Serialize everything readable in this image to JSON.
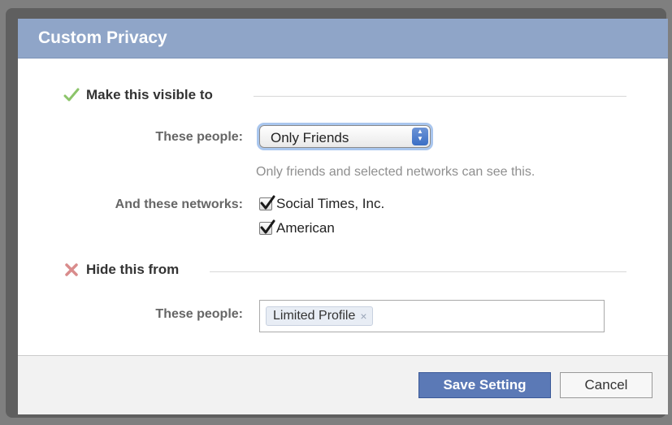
{
  "dialog": {
    "title": "Custom Privacy"
  },
  "visible_section": {
    "heading": "Make this visible to",
    "icon": "check-icon",
    "icon_color": "#8cc46a",
    "people_label": "These people:",
    "people_select": {
      "selected": "Only Friends"
    },
    "hint": "Only friends and selected networks can see this.",
    "networks_label": "And these networks:",
    "networks": [
      {
        "label": "Social Times, Inc.",
        "checked": true
      },
      {
        "label": "American",
        "checked": true
      }
    ]
  },
  "hide_section": {
    "heading": "Hide this from",
    "icon": "x-icon",
    "icon_color": "#d98c8c",
    "people_label": "These people:",
    "tokens": [
      {
        "label": "Limited Profile",
        "remove_glyph": "×"
      }
    ]
  },
  "footer": {
    "save_label": "Save Setting",
    "cancel_label": "Cancel"
  },
  "colors": {
    "titlebar": "#8fa5c8",
    "primary_button": "#5b79b6"
  }
}
